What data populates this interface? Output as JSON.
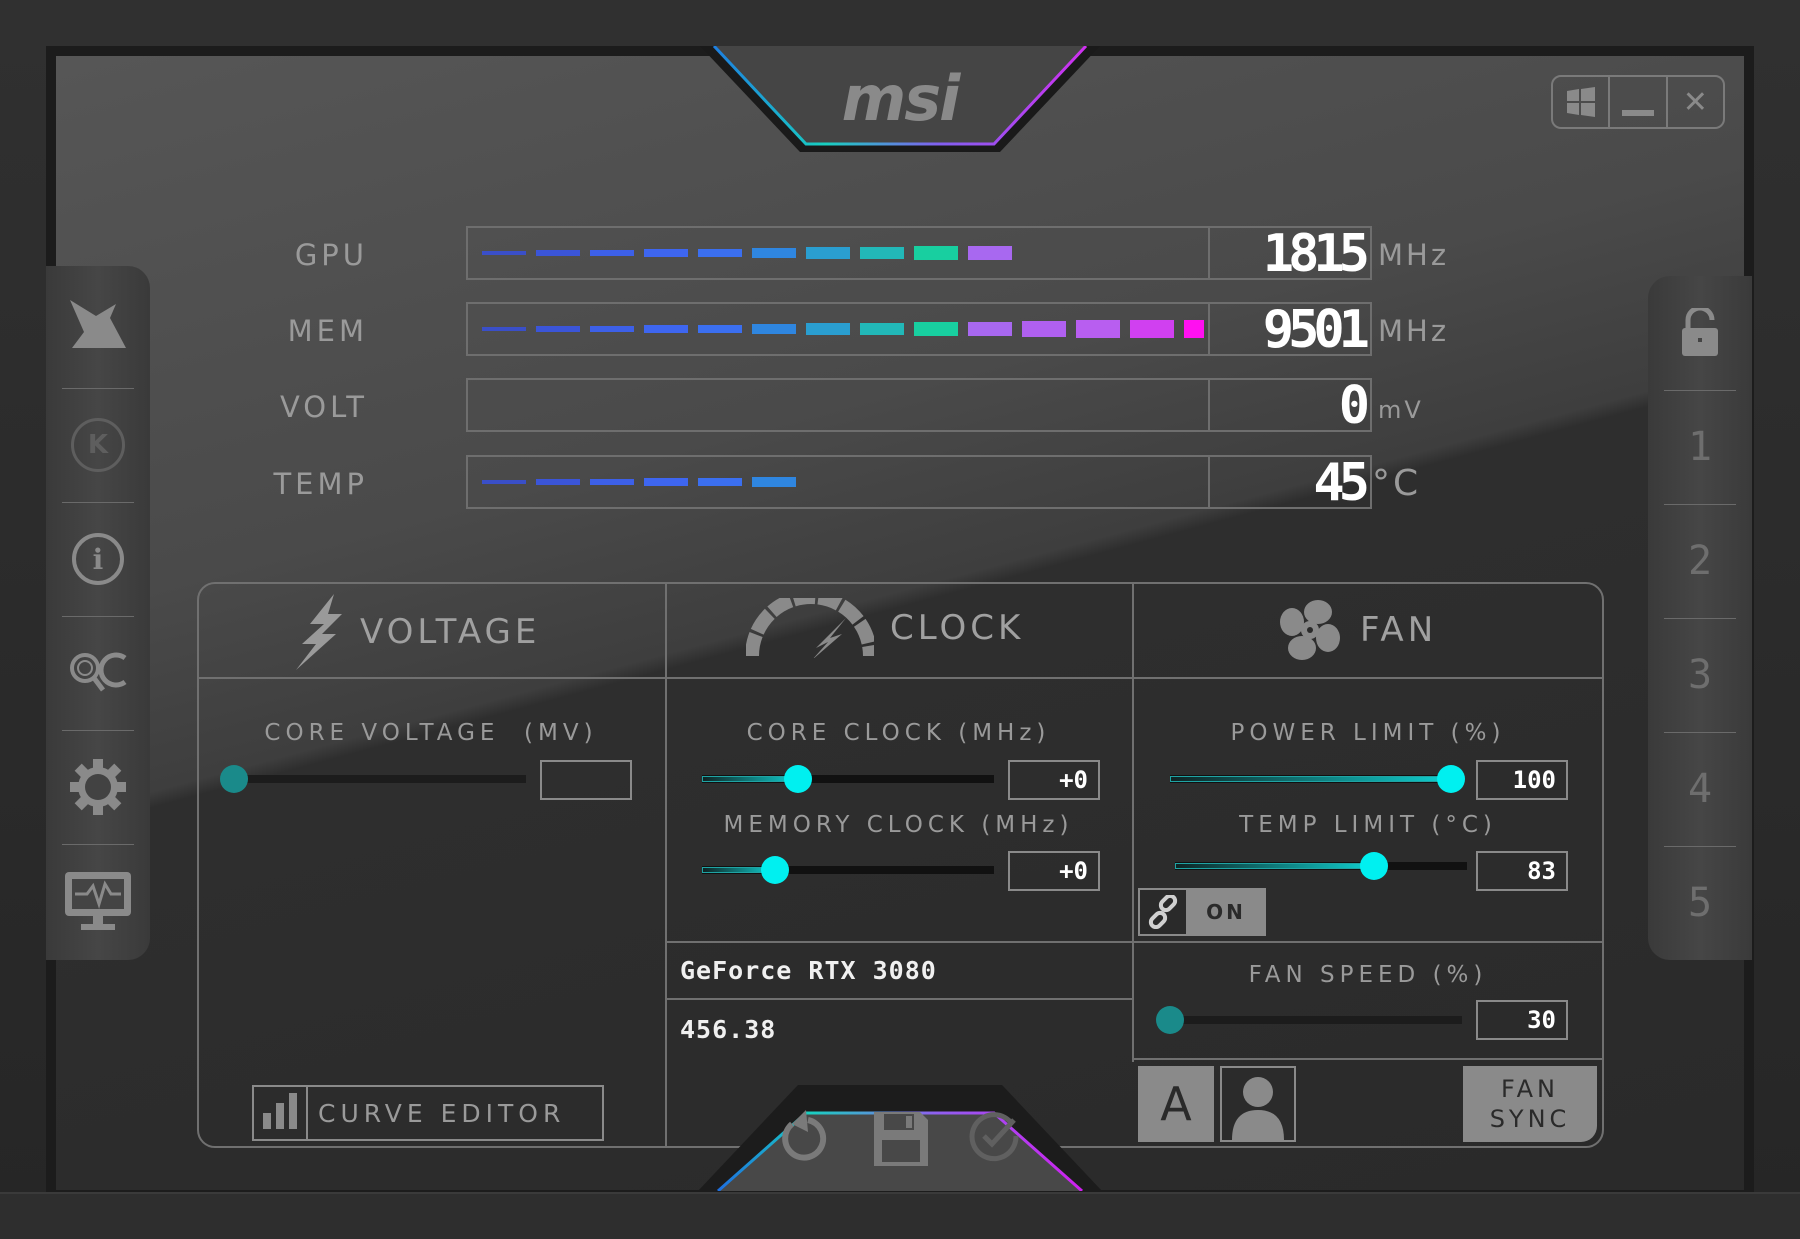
{
  "app": {
    "brand": "msi"
  },
  "window_controls": {
    "windows_icon": "windows-logo-icon",
    "minimize": "_",
    "close": "✕"
  },
  "left_sidebar": {
    "items": [
      {
        "name": "afterburner-logo",
        "icon": "jet-icon"
      },
      {
        "name": "kombustor",
        "icon": "k-circle-icon",
        "label": "K"
      },
      {
        "name": "info",
        "icon": "info-icon",
        "label": "i"
      },
      {
        "name": "oc-scanner",
        "icon": "oc-scanner-icon",
        "label": "OC"
      },
      {
        "name": "settings",
        "icon": "gear-icon"
      },
      {
        "name": "monitor",
        "icon": "monitor-pulse-icon"
      }
    ]
  },
  "right_sidebar": {
    "lock_icon": "unlock-icon",
    "profiles": [
      "1",
      "2",
      "3",
      "4",
      "5"
    ]
  },
  "monitor": {
    "rows": [
      {
        "label": "GPU",
        "value": "1815",
        "unit": "MHz",
        "bar_segments": 10
      },
      {
        "label": "MEM",
        "value": "9501",
        "unit": "MHz",
        "bar_segments": 14
      },
      {
        "label": "VOLT",
        "value": "0",
        "unit": "mV",
        "bar_segments": 0
      },
      {
        "label": "TEMP",
        "value": "45",
        "unit": "°C",
        "bar_segments": 6
      }
    ],
    "segment_colors": [
      "#3a4fc8",
      "#3b55d8",
      "#3d60e8",
      "#3e66f0",
      "#3b6ff0",
      "#2f86e0",
      "#2a9ed0",
      "#22b8b8",
      "#18cfa0",
      "#a868f0",
      "#b060f0",
      "#b85ef0",
      "#d040f0",
      "#ff10f0"
    ]
  },
  "sections": {
    "voltage": {
      "title": "VOLTAGE",
      "core_voltage": {
        "label": "CORE VOLTAGE",
        "unit": "(MV)",
        "value": "",
        "fraction": 0.0
      },
      "curve_editor": "CURVE EDITOR"
    },
    "clock": {
      "title": "CLOCK",
      "core_clock": {
        "label": "CORE CLOCK",
        "unit": "(MHz)",
        "value": "+0",
        "fraction": 0.33
      },
      "memory_clock": {
        "label": "MEMORY CLOCK",
        "unit": "(MHz)",
        "value": "+0",
        "fraction": 0.25
      },
      "gpu_name": "GeForce RTX 3080",
      "driver_version": "456.38"
    },
    "fan": {
      "title": "FAN",
      "power_limit": {
        "label": "POWER LIMIT",
        "unit": "(%)",
        "value": "100",
        "fraction": 0.97
      },
      "temp_limit": {
        "label": "TEMP LIMIT",
        "unit": "(°C)",
        "value": "83",
        "fraction": 0.68
      },
      "link_toggle": {
        "icon": "link-icon",
        "state": "ON"
      },
      "fan_speed": {
        "label": "FAN SPEED",
        "unit": "(%)",
        "value": "30",
        "fraction": 0.0
      },
      "auto_button": "A",
      "user_icon": "user-icon",
      "fan_sync": [
        "FAN",
        "SYNC"
      ]
    }
  },
  "bottom_actions": [
    {
      "name": "reset",
      "icon": "reset-icon"
    },
    {
      "name": "save",
      "icon": "save-icon"
    },
    {
      "name": "apply",
      "icon": "check-icon"
    }
  ]
}
